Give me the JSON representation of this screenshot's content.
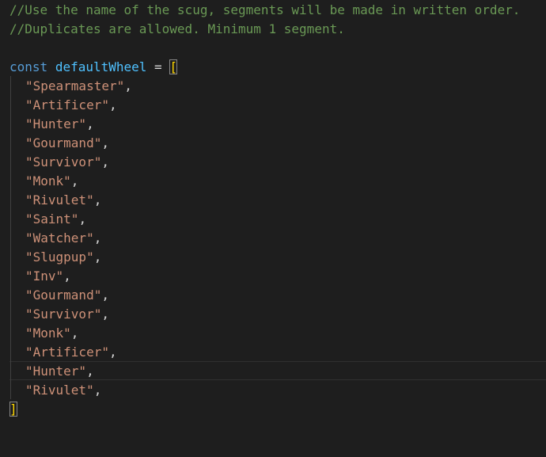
{
  "comments": [
    "//Use the name of the scug, segments will be made in written order.",
    "//Duplicates are allowed. Minimum 1 segment."
  ],
  "declaration": {
    "keyword": "const",
    "name": "defaultWheel",
    "operator": "=",
    "open_bracket": "["
  },
  "entries": [
    "\"Spearmaster\"",
    "\"Artificer\"",
    "\"Hunter\"",
    "\"Gourmand\"",
    "\"Survivor\"",
    "\"Monk\"",
    "\"Rivulet\"",
    "\"Saint\"",
    "\"Watcher\"",
    "\"Slugpup\"",
    "\"Inv\"",
    "\"Gourmand\"",
    "\"Survivor\"",
    "\"Monk\"",
    "\"Artificer\"",
    "\"Hunter\"",
    "\"Rivulet\""
  ],
  "separator": ",",
  "close_bracket": "]",
  "colors": {
    "background": "#1e1e1e",
    "comment": "#6a9955",
    "keyword": "#569cd6",
    "variable": "#4fc1ff",
    "string": "#ce9178",
    "bracket": "#ffd700"
  }
}
